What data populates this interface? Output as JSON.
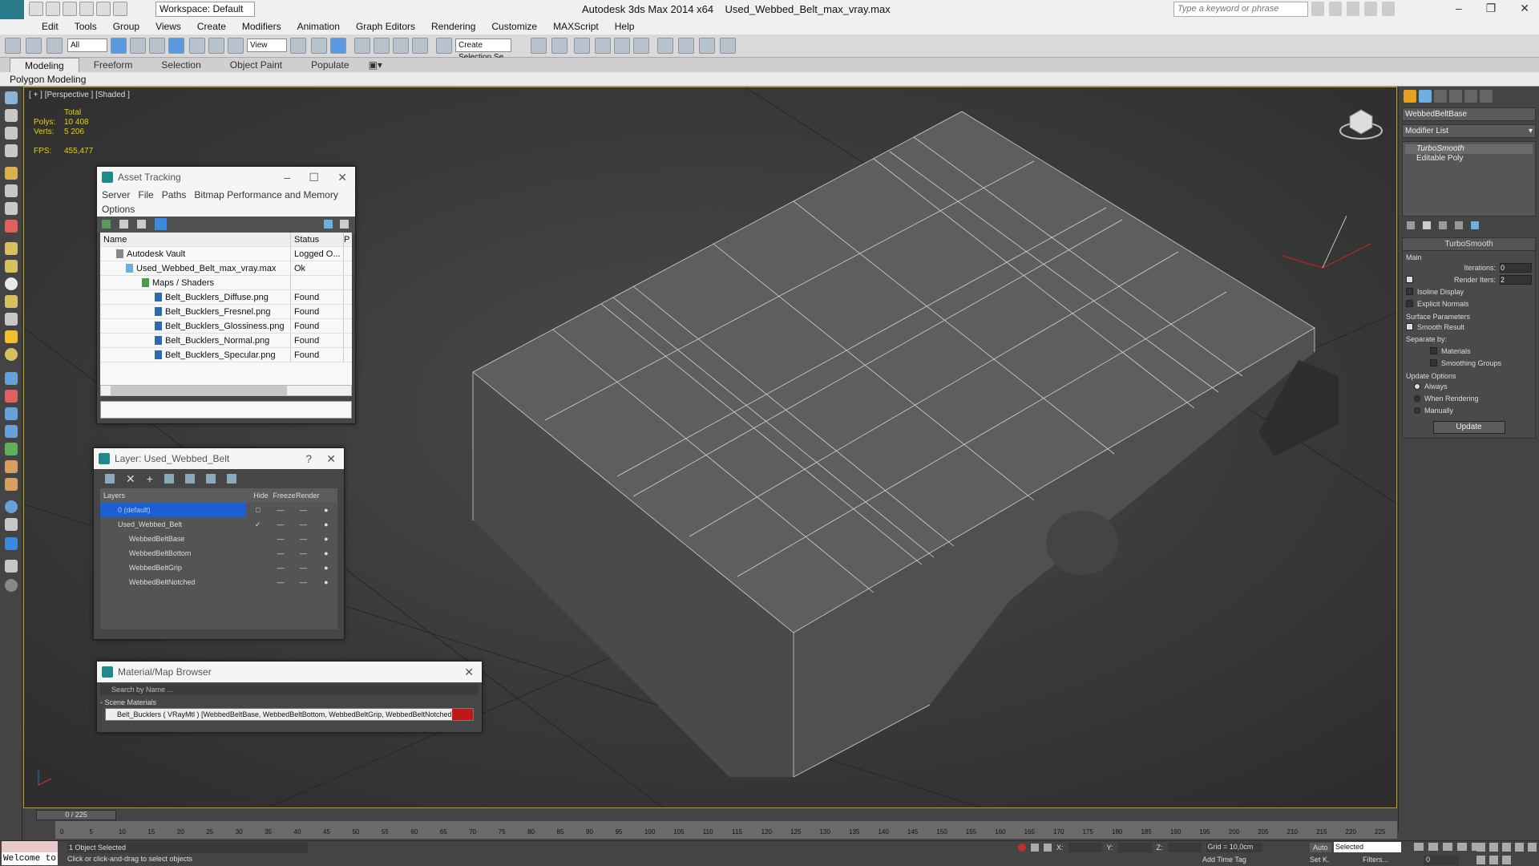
{
  "app": {
    "title": "Autodesk 3ds Max  2014 x64",
    "file": "Used_Webbed_Belt_max_vray.max",
    "workspace": "Workspace: Default",
    "search_placeholder": "Type a keyword or phrase"
  },
  "menu": [
    "Edit",
    "Tools",
    "Group",
    "Views",
    "Create",
    "Modifiers",
    "Animation",
    "Graph Editors",
    "Rendering",
    "Customize",
    "MAXScript",
    "Help"
  ],
  "toolbar": {
    "filter": "All",
    "view": "View",
    "selection_set": "Create Selection Se"
  },
  "ribbon": {
    "tabs": [
      "Modeling",
      "Freeform",
      "Selection",
      "Object Paint",
      "Populate"
    ],
    "panel": "Polygon Modeling"
  },
  "viewport": {
    "label": "[ + ] [Perspective ] [Shaded ]",
    "stats": {
      "total_label": "Total",
      "polys_label": "Polys:",
      "polys": "10 408",
      "verts_label": "Verts:",
      "verts": "5 206",
      "fps_label": "FPS:",
      "fps": "455,477"
    }
  },
  "asset_tracking": {
    "title": "Asset Tracking",
    "menu": [
      "Server",
      "File",
      "Paths",
      "Bitmap Performance and Memory",
      "Options"
    ],
    "headers": {
      "name": "Name",
      "status": "Status",
      "p": "P"
    },
    "rows": [
      {
        "name": "Autodesk Vault",
        "status": "Logged O..."
      },
      {
        "name": "Used_Webbed_Belt_max_vray.max",
        "status": "Ok"
      },
      {
        "name": "Maps / Shaders",
        "status": ""
      },
      {
        "name": "Belt_Bucklers_Diffuse.png",
        "status": "Found"
      },
      {
        "name": "Belt_Bucklers_Fresnel.png",
        "status": "Found"
      },
      {
        "name": "Belt_Bucklers_Glossiness.png",
        "status": "Found"
      },
      {
        "name": "Belt_Bucklers_Normal.png",
        "status": "Found"
      },
      {
        "name": "Belt_Bucklers_Specular.png",
        "status": "Found"
      }
    ]
  },
  "layer": {
    "title": "Layer: Used_Webbed_Belt",
    "question": "?",
    "headers": {
      "layers": "Layers",
      "hide": "Hide",
      "freeze": "Freeze",
      "render": "Render"
    },
    "rows": [
      "0 (default)",
      "Used_Webbed_Belt",
      "WebbedBeltBase",
      "WebbedBeltBottom",
      "WebbedBeltGrip",
      "WebbedBeltNotched"
    ]
  },
  "material_browser": {
    "title": "Material/Map Browser",
    "search": "Search by Name ...",
    "group": "- Scene Materials",
    "item": "Belt_Bucklers ( VRayMtl ) [WebbedBeltBase, WebbedBeltBottom, WebbedBeltGrip, WebbedBeltNotched]"
  },
  "command_panel": {
    "object_name": "WebbedBeltBase",
    "modifier_list": "Modifier List",
    "stack": [
      "TurboSmooth",
      "Editable Poly"
    ],
    "turbosmooth": {
      "title": "TurboSmooth",
      "main": "Main",
      "iterations_label": "Iterations:",
      "iterations": "0",
      "render_iters_label": "Render Iters:",
      "render_iters": "2",
      "isoline": "Isoline Display",
      "explicit": "Explicit Normals",
      "surface": "Surface Parameters",
      "smooth": "Smooth Result",
      "separate": "Separate by:",
      "materials": "Materials",
      "smoothing": "Smoothing Groups",
      "update_options": "Update Options",
      "always": "Always",
      "when_rendering": "When Rendering",
      "manually": "Manually",
      "update": "Update"
    }
  },
  "timeline": {
    "frame": "0 / 225",
    "ticks": [
      "0",
      "5",
      "10",
      "15",
      "20",
      "25",
      "30",
      "35",
      "40",
      "45",
      "50",
      "55",
      "60",
      "65",
      "70",
      "75",
      "80",
      "85",
      "90",
      "95",
      "100",
      "105",
      "110",
      "115",
      "120",
      "125",
      "130",
      "135",
      "140",
      "145",
      "150",
      "155",
      "160",
      "165",
      "170",
      "175",
      "180",
      "185",
      "190",
      "195",
      "200",
      "205",
      "210",
      "215",
      "220",
      "225"
    ]
  },
  "status": {
    "selected": "1 Object Selected",
    "prompt": "Click or click-and-drag to select objects",
    "maxscript": "Welcome to",
    "x": "X:",
    "y": "Y:",
    "z": "Z:",
    "grid": "Grid = 10,0cm",
    "auto": "Auto",
    "selected_mode": "Selected",
    "set_key": "Set K.",
    "filters": "Filters...",
    "add_time_tag": "Add Time Tag",
    "frame": "0"
  }
}
